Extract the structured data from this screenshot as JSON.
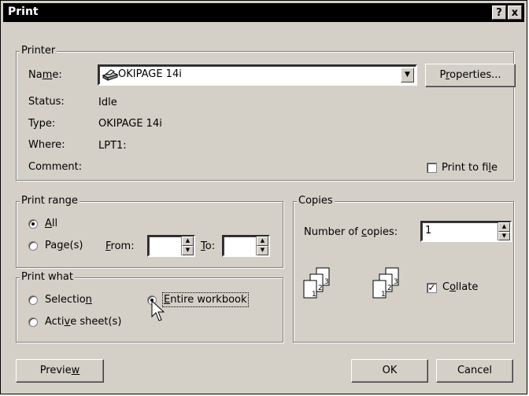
{
  "window": {
    "title": "Print",
    "help": "?",
    "close": "x"
  },
  "printer": {
    "group_label": "Printer",
    "name_label": "Name:",
    "name_value": "OKIPAGE 14i",
    "properties_button": "Properties...",
    "status_label": "Status:",
    "status_value": "Idle",
    "type_label": "Type:",
    "type_value": "OKIPAGE 14i",
    "where_label": "Where:",
    "where_value": "LPT1:",
    "comment_label": "Comment:",
    "print_to_file": "Print to file",
    "print_to_file_checked": false
  },
  "print_range": {
    "group_label": "Print range",
    "all": "All",
    "pages": "Page(s)",
    "from": "From:",
    "to": "To:",
    "from_value": "",
    "to_value": "",
    "selected": "All"
  },
  "print_what": {
    "group_label": "Print what",
    "selection": "Selection",
    "entire_workbook": "Entire workbook",
    "active_sheets": "Active sheet(s)",
    "selected": "Entire workbook"
  },
  "copies": {
    "group_label": "Copies",
    "number_label": "Number of copies:",
    "number_value": "1",
    "collate": "Collate",
    "collate_checked": true
  },
  "buttons": {
    "preview": "Preview",
    "ok": "OK",
    "cancel": "Cancel"
  }
}
